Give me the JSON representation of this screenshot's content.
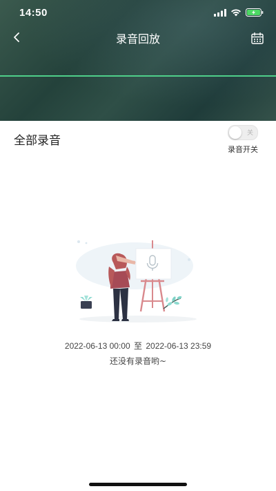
{
  "status_bar": {
    "time": "14:50"
  },
  "nav": {
    "title": "录音回放",
    "back_icon": "chevron-left-icon",
    "calendar_icon": "calendar-icon"
  },
  "filter": {
    "all_label": "全部录音",
    "toggle_label": "录音开关",
    "toggle_state_text": "关",
    "toggle_on": false
  },
  "empty_state": {
    "date_start": "2022-06-13 00:00",
    "date_separator": "至",
    "date_end": "2022-06-13 23:59",
    "message": "还没有录音哟~"
  },
  "colors": {
    "header_bg": "#2c4a43",
    "wave_line": "#4fd08a",
    "battery_fill": "#4cd964"
  }
}
